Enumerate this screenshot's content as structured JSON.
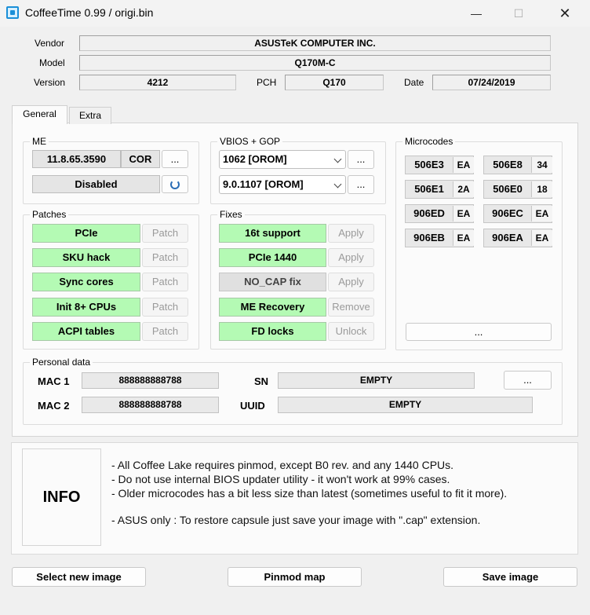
{
  "window": {
    "title": "CoffeeTime 0.99  /  origi.bin",
    "minimize": "—",
    "maximize": "☐",
    "close": "✕"
  },
  "header": {
    "vendor_label": "Vendor",
    "vendor_value": "ASUSTeK COMPUTER INC.",
    "model_label": "Model",
    "model_value": "Q170M-C",
    "version_label": "Version",
    "version_value": "4212",
    "pch_label": "PCH",
    "pch_value": "Q170",
    "date_label": "Date",
    "date_value": "07/24/2019"
  },
  "tabs": [
    {
      "label": "General",
      "active": true
    },
    {
      "label": "Extra",
      "active": false
    }
  ],
  "me": {
    "title": "ME",
    "version": "11.8.65.3590",
    "type": "COR",
    "more": "...",
    "status": "Disabled"
  },
  "vbios": {
    "title": "VBIOS + GOP",
    "vbios_value": "1062 [OROM]",
    "gop_value": "9.0.1107 [OROM]",
    "more1": "...",
    "more2": "..."
  },
  "microcodes": {
    "title": "Microcodes",
    "items": [
      {
        "id": "506E3",
        "rev": "EA"
      },
      {
        "id": "506E8",
        "rev": "34"
      },
      {
        "id": "506E1",
        "rev": "2A"
      },
      {
        "id": "506E0",
        "rev": "18"
      },
      {
        "id": "906ED",
        "rev": "EA"
      },
      {
        "id": "906EC",
        "rev": "EA"
      },
      {
        "id": "906EB",
        "rev": "EA"
      },
      {
        "id": "906EA",
        "rev": "EA"
      }
    ],
    "more": "..."
  },
  "patches": {
    "title": "Patches",
    "items": [
      {
        "label": "PCIe",
        "action": "Patch"
      },
      {
        "label": "SKU hack",
        "action": "Patch"
      },
      {
        "label": "Sync cores",
        "action": "Patch"
      },
      {
        "label": "Init 8+ CPUs",
        "action": "Patch"
      },
      {
        "label": "ACPI tables",
        "action": "Patch"
      }
    ]
  },
  "fixes": {
    "title": "Fixes",
    "items": [
      {
        "label": "16t support",
        "action": "Apply"
      },
      {
        "label": "PCIe 1440",
        "action": "Apply"
      },
      {
        "label": "NO_CAP fix",
        "action": "Apply"
      },
      {
        "label": "ME Recovery",
        "action": "Remove"
      },
      {
        "label": "FD locks",
        "action": "Unlock"
      }
    ]
  },
  "personal": {
    "title": "Personal data",
    "mac1_label": "MAC 1",
    "mac1_value": "888888888788",
    "mac2_label": "MAC 2",
    "mac2_value": "888888888788",
    "sn_label": "SN",
    "sn_value": "EMPTY",
    "uuid_label": "UUID",
    "uuid_value": "EMPTY",
    "more": "..."
  },
  "info": {
    "heading": "INFO",
    "lines": [
      "- All Coffee Lake requires pinmod, except B0 rev. and any 1440 CPUs.",
      "- Do not use internal BIOS updater utility - it won't work at 99% cases.",
      "- Older microcodes has a bit less size than latest (sometimes useful to fit it more).",
      "- ASUS only : To restore capsule just save your image with \".cap\" extension."
    ]
  },
  "footer": {
    "select_label": "Select new image",
    "pinmod_label": "Pinmod map",
    "save_label": "Save image"
  }
}
